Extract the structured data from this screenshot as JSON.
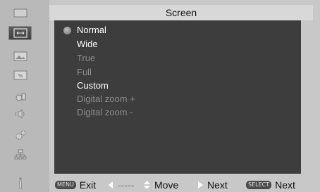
{
  "header": {
    "title": "Screen"
  },
  "options": [
    {
      "label": "Normal",
      "enabled": true,
      "selected": true
    },
    {
      "label": "Wide",
      "enabled": true,
      "selected": false
    },
    {
      "label": "True",
      "enabled": false,
      "selected": false
    },
    {
      "label": "Full",
      "enabled": false,
      "selected": false
    },
    {
      "label": "Custom",
      "enabled": true,
      "selected": false
    },
    {
      "label": "Digital zoom +",
      "enabled": false,
      "selected": false
    },
    {
      "label": "Digital zoom -",
      "enabled": false,
      "selected": false
    }
  ],
  "sidebar": {
    "icons": [
      {
        "name": "display-icon",
        "active": false
      },
      {
        "name": "screen-icon",
        "active": true
      },
      {
        "name": "image-icon",
        "active": false
      },
      {
        "name": "image-adjust-icon",
        "active": false
      },
      {
        "name": "setting-icon",
        "active": false
      },
      {
        "name": "sound-icon",
        "active": false
      },
      {
        "name": "gear-icon",
        "active": false
      },
      {
        "name": "network-icon",
        "active": false
      },
      {
        "name": "info-icon",
        "active": false
      }
    ]
  },
  "footer": {
    "exit_key": "MENU",
    "exit_label": "Exit",
    "back_label": "-----",
    "move_label": "Move",
    "next_label": "Next",
    "select_key": "SELECT",
    "select_label": "Next"
  },
  "colors": {
    "panel": "#3d3d3d",
    "enabled_text": "#ffffff",
    "disabled_text": "#8d8d8d"
  }
}
